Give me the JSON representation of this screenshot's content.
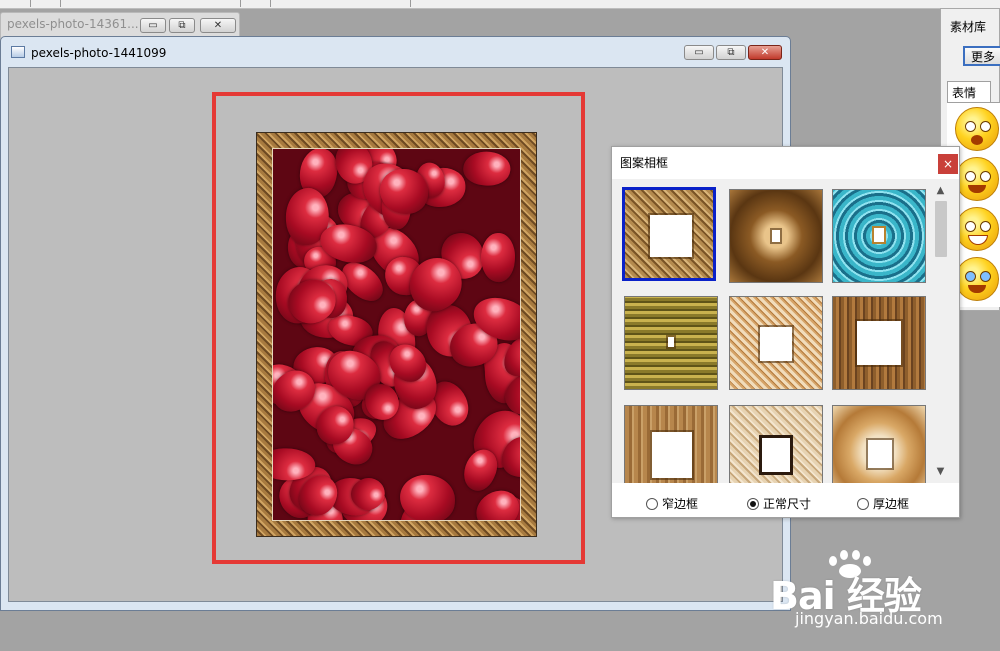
{
  "background_window": {
    "title": "pexels-photo-14361..."
  },
  "image_window": {
    "title": "pexels-photo-1441099"
  },
  "material_library": {
    "title": "素材库",
    "more_button": "更多",
    "tab_label": "表情",
    "items": [
      "smiley-shocked-icon",
      "smiley-crying-icon",
      "smiley-grin-icon",
      "smiley-cry-icon"
    ]
  },
  "frame_dialog": {
    "title": "图案相框",
    "close_glyph": "×",
    "selected_index": 0,
    "thumbnails": [
      "frame-thumb-1",
      "frame-thumb-2",
      "frame-thumb-3",
      "frame-thumb-4",
      "frame-thumb-5",
      "frame-thumb-6",
      "frame-thumb-7",
      "frame-thumb-8",
      "frame-thumb-9"
    ],
    "options": [
      {
        "label": "窄边框",
        "checked": false
      },
      {
        "label": "正常尺寸",
        "checked": true
      },
      {
        "label": "厚边框",
        "checked": false
      }
    ]
  },
  "window_controls": {
    "minimize": "▭",
    "restore": "⧉",
    "close": "✕"
  },
  "watermark": {
    "logo": "Bai 经验",
    "url": "jingyan.baidu.com"
  },
  "colors": {
    "highlight_rect": "#e53935",
    "selection_border": "#0a21c8",
    "close_button": "#c9403a"
  }
}
